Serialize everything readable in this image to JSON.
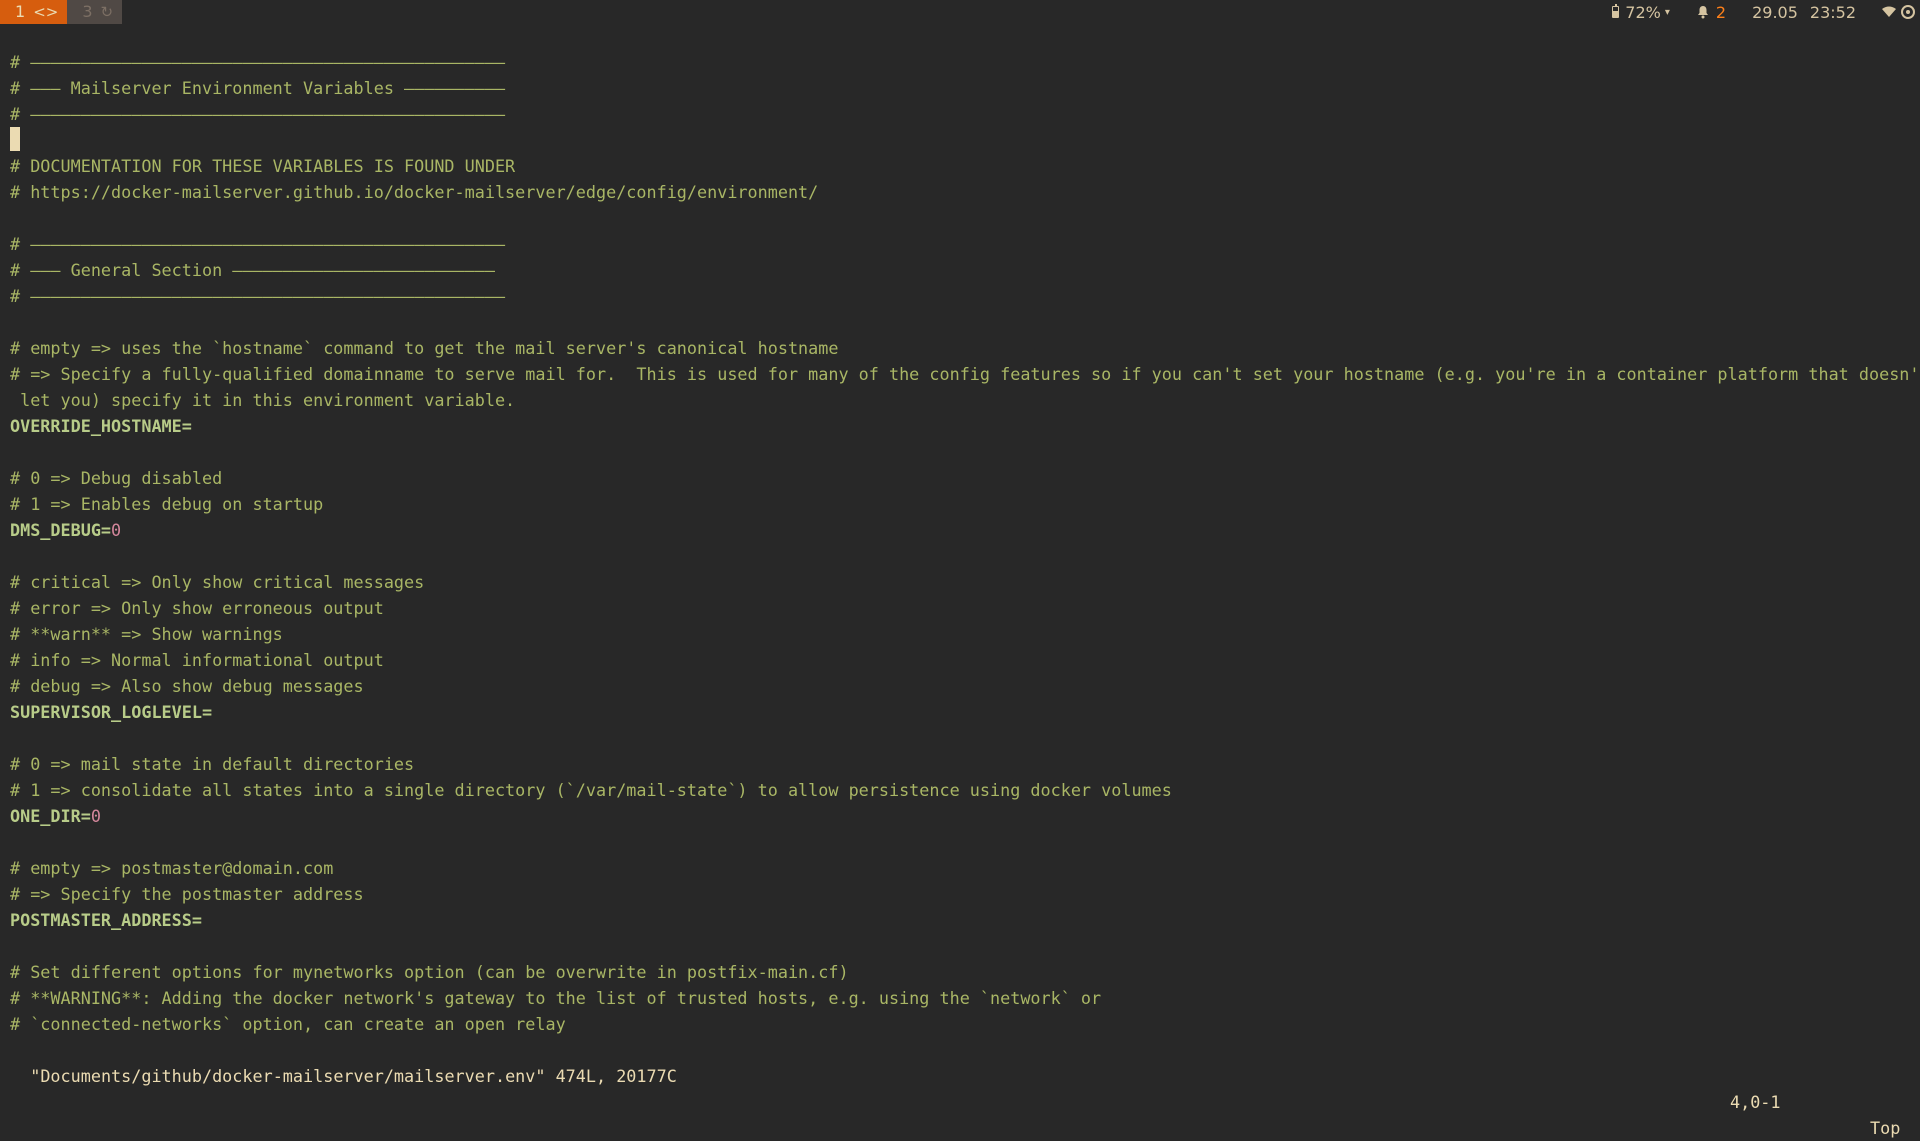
{
  "workspaces": [
    {
      "number": "1",
      "glyph": "<>",
      "active": true
    },
    {
      "number": "3",
      "glyph": "↻",
      "active": false
    }
  ],
  "tray": {
    "battery": "72%",
    "battery_caret": "▾",
    "alert_icon": "bell-icon",
    "alerts": "2",
    "date": "29.05",
    "time": "23:52",
    "wifi_icon": "wifi-icon",
    "network_icon": "network-icon"
  },
  "editor": {
    "lines": [
      "# ———————————————————————————————————————————————",
      "# ——— Mailserver Environment Variables ——————————",
      "# ———————————————————————————————————————————————",
      "",
      "# DOCUMENTATION FOR THESE VARIABLES IS FOUND UNDER",
      "# https://docker-mailserver.github.io/docker-mailserver/edge/config/environment/",
      "",
      "# ———————————————————————————————————————————————",
      "# ——— General Section ——————————————————————————",
      "# ———————————————————————————————————————————————",
      "",
      "# empty => uses the `hostname` command to get the mail server's canonical hostname",
      "# => Specify a fully-qualified domainname to serve mail for.  This is used for many of the config features so if you can't set your hostname (e.g. you're in a container platform that doesn't",
      " let you) specify it in this environment variable.",
      "OVERRIDE_HOSTNAME=",
      "",
      "# 0 => Debug disabled",
      "# 1 => Enables debug on startup",
      "DMS_DEBUG=0",
      "",
      "# critical => Only show critical messages",
      "# error => Only show erroneous output",
      "# **warn** => Show warnings",
      "# info => Normal informational output",
      "# debug => Also show debug messages",
      "SUPERVISOR_LOGLEVEL=",
      "",
      "# 0 => mail state in default directories",
      "# 1 => consolidate all states into a single directory (`/var/mail-state`) to allow persistence using docker volumes",
      "ONE_DIR=0",
      "",
      "# empty => postmaster@domain.com",
      "# => Specify the postmaster address",
      "POSTMASTER_ADDRESS=",
      "",
      "# Set different options for mynetworks option (can be overwrite in postfix-main.cf)",
      "# **WARNING**: Adding the docker network's gateway to the list of trusted hosts, e.g. using the `network` or",
      "# `connected-networks` option, can create an open relay"
    ]
  },
  "status": {
    "file_info": "\"Documents/github/docker-mailserver/mailserver.env\" 474L, 20177C",
    "position": "4,0-1",
    "scroll": "Top"
  },
  "colors": {
    "background": "#282828",
    "comment": "#a9b665",
    "variable": "#b8cc89",
    "number": "#d3869b",
    "active_workspace": "#d65d0e"
  }
}
